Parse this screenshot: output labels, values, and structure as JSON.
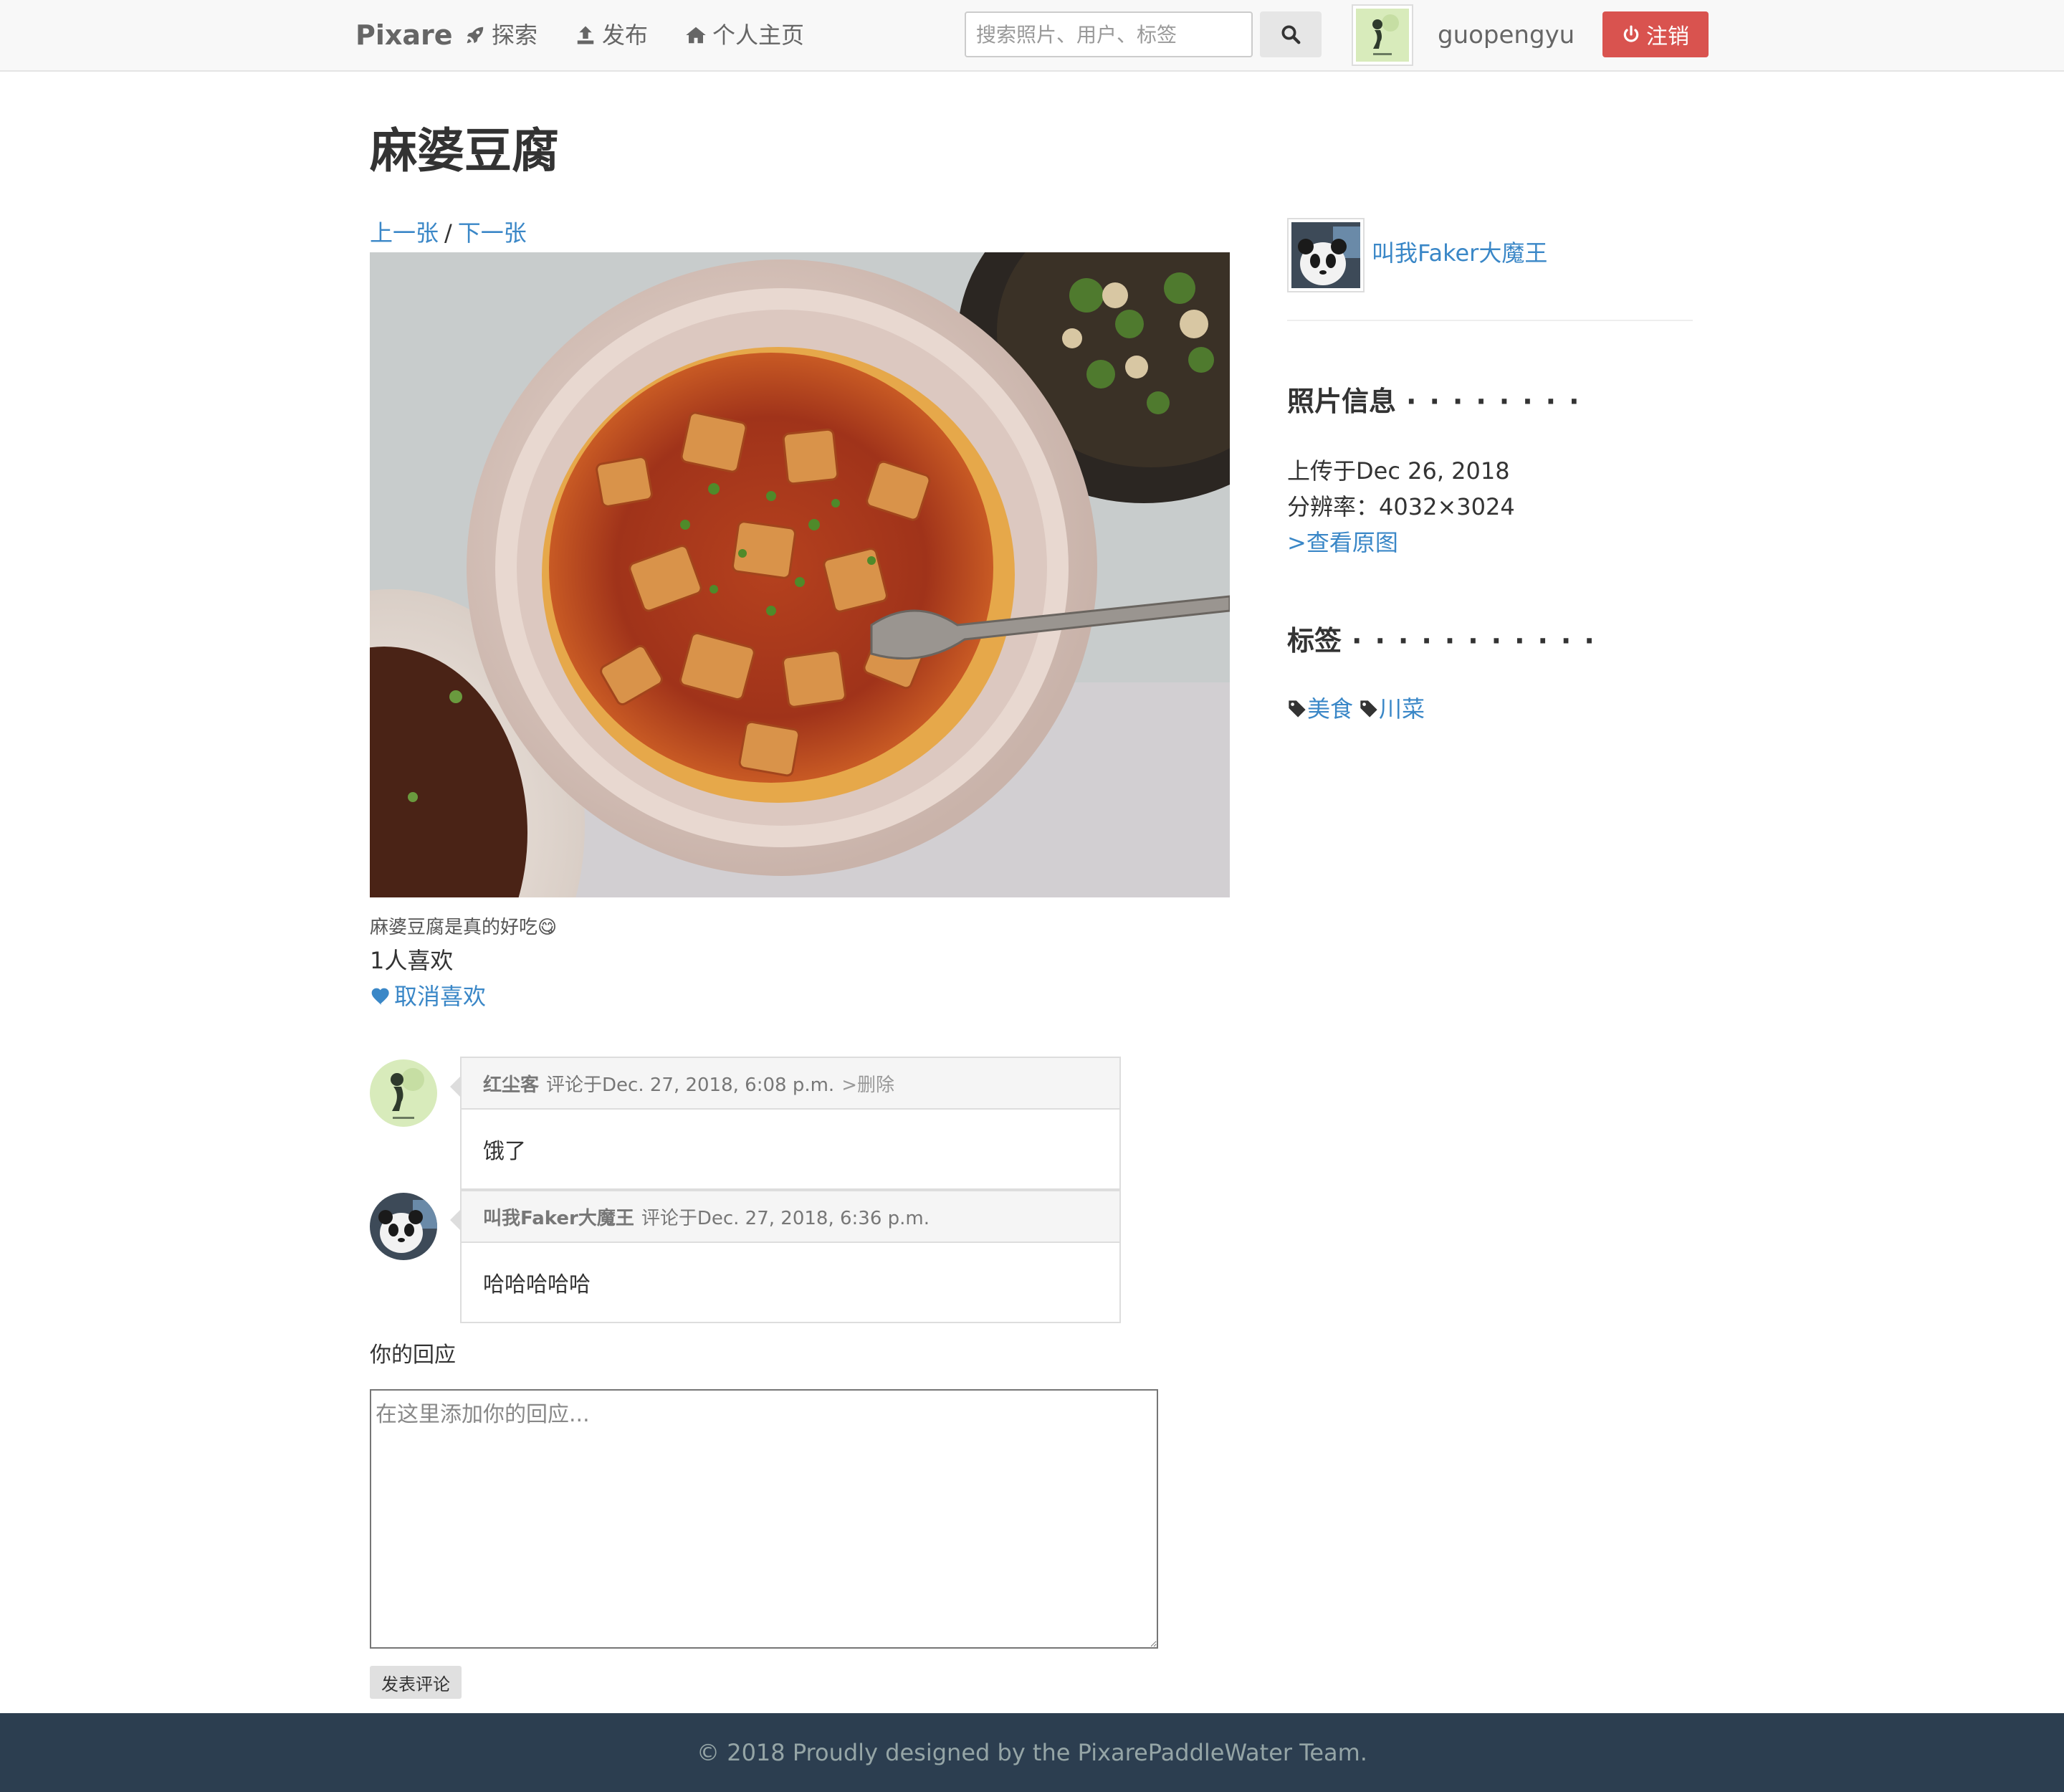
{
  "navbar": {
    "brand": "Pixare",
    "links": [
      {
        "label": "探索",
        "icon": "rocket-icon"
      },
      {
        "label": "发布",
        "icon": "upload-icon"
      },
      {
        "label": "个人主页",
        "icon": "home-icon"
      }
    ],
    "search": {
      "placeholder": "搜索照片、用户、标签",
      "value": "",
      "button_icon": "search-icon"
    },
    "username": "guopengyu",
    "logout_label": "注销",
    "logout_icon": "power-icon",
    "colors": {
      "bg": "#f8f8f8",
      "logout": "#d9534f"
    }
  },
  "photo": {
    "title": "麻婆豆腐",
    "prev_label": "上一张",
    "separator": "/",
    "next_label": "下一张",
    "caption": "麻婆豆腐是真的好吃😋",
    "likes_text": "1人喜欢",
    "unlike_label": "取消喜欢"
  },
  "comments": [
    {
      "author": "红尘客",
      "meta": "评论于Dec. 27, 2018, 6:08 p.m.",
      "delete_label": ">删除",
      "body": "饿了",
      "avatar": "green-avatar"
    },
    {
      "author": "叫我Faker大魔王",
      "meta": "评论于Dec. 27, 2018, 6:36 p.m.",
      "delete_label": "",
      "body": "哈哈哈哈哈",
      "avatar": "panda-avatar"
    }
  ],
  "reply": {
    "label": "你的回应",
    "placeholder": "在这里添加你的回应...",
    "submit_label": "发表评论"
  },
  "sidebar": {
    "author_name": "叫我Faker大魔王",
    "info_heading": "照片信息",
    "info_dots": "········",
    "uploaded": "上传于Dec 26, 2018",
    "resolution": "分辨率：4032×3024",
    "view_original": ">查看原图",
    "tags_heading": "标签",
    "tags_dots": "···········",
    "tags": [
      "美食",
      "川菜"
    ]
  },
  "footer": {
    "text": "© 2018 Proudly designed by the PixarePaddleWater Team."
  },
  "colors": {
    "link": "#3a87c7",
    "footer_bg": "#2c3e50",
    "footer_text": "#95a5a6"
  }
}
